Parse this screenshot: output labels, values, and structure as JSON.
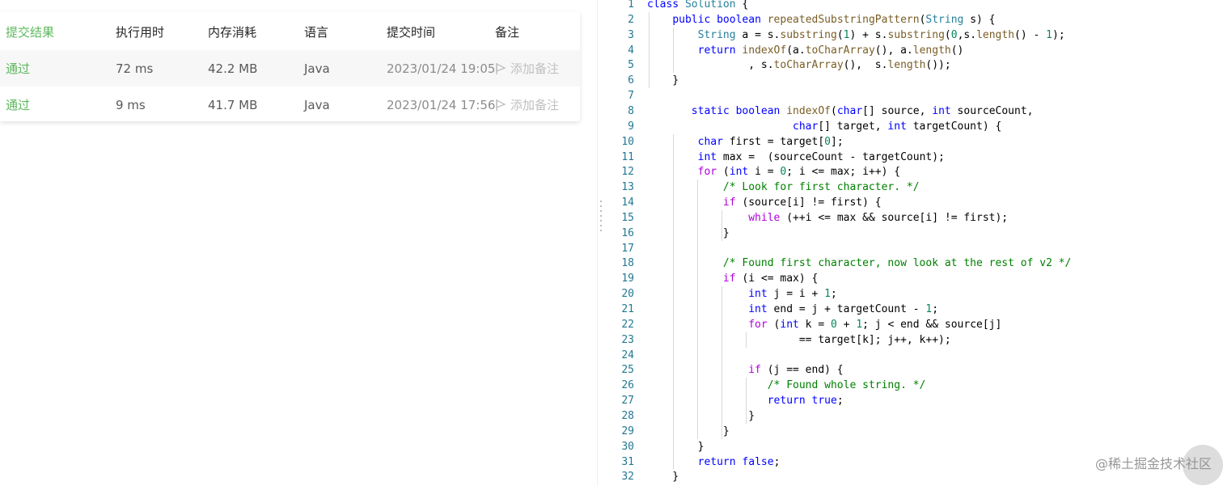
{
  "submissions": {
    "headers": {
      "status": "提交结果",
      "runtime": "执行用时",
      "memory": "内存消耗",
      "language": "语言",
      "submit_time": "提交时间",
      "note": "备注"
    },
    "rows": [
      {
        "status": "通过",
        "runtime": "72 ms",
        "memory": "42.2 MB",
        "language": "Java",
        "submit_time": "2023/01/24 19:05",
        "note": "添加备注"
      },
      {
        "status": "通过",
        "runtime": "9 ms",
        "memory": "41.7 MB",
        "language": "Java",
        "submit_time": "2023/01/24 17:56",
        "note": "添加备注"
      }
    ],
    "status_color": "#5cb85c"
  },
  "editor": {
    "line_numbers": [
      "1",
      "2",
      "3",
      "4",
      "5",
      "6",
      "7",
      "8",
      "9",
      "10",
      "11",
      "12",
      "13",
      "14",
      "15",
      "16",
      "17",
      "18",
      "19",
      "20",
      "21",
      "22",
      "23",
      "24",
      "25",
      "26",
      "27",
      "28",
      "29",
      "30",
      "31",
      "32"
    ],
    "lines": [
      "class Solution {",
      "    public boolean repeatedSubstringPattern(String s) {",
      "        String a = s.substring(1) + s.substring(0,s.length() - 1);",
      "        return indexOf(a.toCharArray(), a.length()",
      "                , s.toCharArray(),  s.length());",
      "    }",
      "",
      "       static boolean indexOf(char[] source, int sourceCount,",
      "                       char[] target, int targetCount) {",
      "        char first = target[0];",
      "        int max =  (sourceCount - targetCount);",
      "        for (int i = 0; i <= max; i++) {",
      "            /* Look for first character. */",
      "            if (source[i] != first) {",
      "                while (++i <= max && source[i] != first);",
      "            }",
      "",
      "            /* Found first character, now look at the rest of v2 */",
      "            if (i <= max) {",
      "                int j = i + 1;",
      "                int end = j + targetCount - 1;",
      "                for (int k = 0 + 1; j < end && source[j]",
      "                        == target[k]; j++, k++);",
      "",
      "                if (j == end) {",
      "                   /* Found whole string. */",
      "                   return true;",
      "                }",
      "            }",
      "        }",
      "        return false;",
      "    }"
    ]
  },
  "watermark": "@稀土掘金技术社区"
}
